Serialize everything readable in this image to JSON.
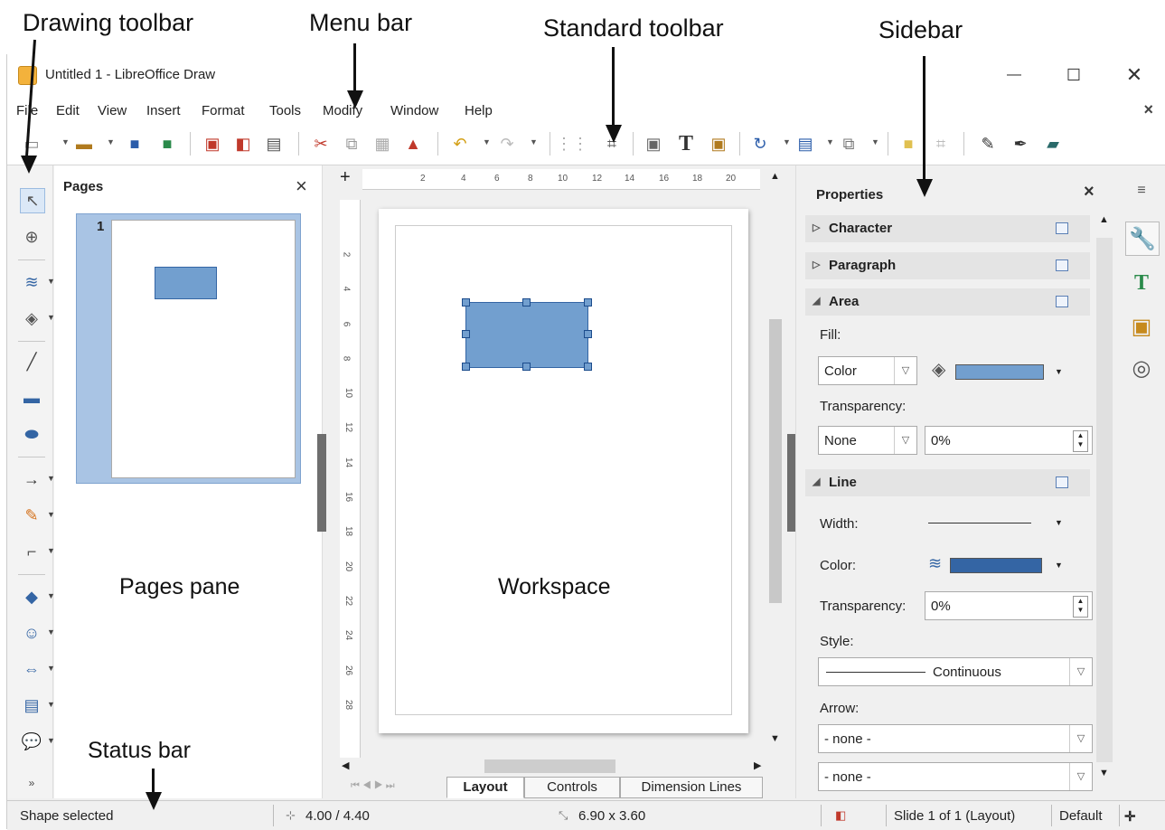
{
  "annotations": {
    "drawing_toolbar": "Drawing toolbar",
    "menu_bar": "Menu bar",
    "standard_toolbar": "Standard toolbar",
    "sidebar": "Sidebar",
    "pages_pane": "Pages pane",
    "workspace": "Workspace",
    "status_bar": "Status bar"
  },
  "window": {
    "title": "Untitled 1 - LibreOffice Draw",
    "minimize": "—",
    "maximize": "☐",
    "close": "✕"
  },
  "menu": {
    "items": [
      "File",
      "Edit",
      "View",
      "Insert",
      "Format",
      "Tools",
      "Modify",
      "Window",
      "Help"
    ],
    "doc_close": "×"
  },
  "pages_pane": {
    "title": "Pages",
    "close": "×",
    "page_number": "1"
  },
  "ruler": {
    "h_ticks": [
      "2",
      "4",
      "6",
      "8",
      "10",
      "12",
      "14",
      "16",
      "18",
      "20"
    ],
    "v_ticks": [
      "2",
      "4",
      "6",
      "8",
      "10",
      "12",
      "14",
      "16",
      "18",
      "20",
      "22",
      "24",
      "26",
      "28"
    ]
  },
  "tabs": [
    "Layout",
    "Controls",
    "Dimension Lines"
  ],
  "sidebar": {
    "title": "Properties",
    "close": "×",
    "sections": {
      "character": "Character",
      "paragraph": "Paragraph",
      "area": "Area",
      "line": "Line"
    },
    "fill_label": "Fill:",
    "fill_value": "Color",
    "area_transparency_label": "Transparency:",
    "area_transparency_mode": "None",
    "area_transparency_value": "0%",
    "width_label": "Width:",
    "color_label": "Color:",
    "line_transparency_label": "Transparency:",
    "line_transparency_value": "0%",
    "style_label": "Style:",
    "style_value": "Continuous",
    "arrow_label": "Arrow:",
    "arrow_start": "- none -",
    "arrow_end": "- none -",
    "fill_color": "#729fcf",
    "line_color": "#3465a4"
  },
  "status": {
    "message": "Shape selected",
    "position": "4.00 / 4.40",
    "size": "6.90 x 3.60",
    "slide": "Slide 1 of 1 (Layout)",
    "style": "Default"
  }
}
